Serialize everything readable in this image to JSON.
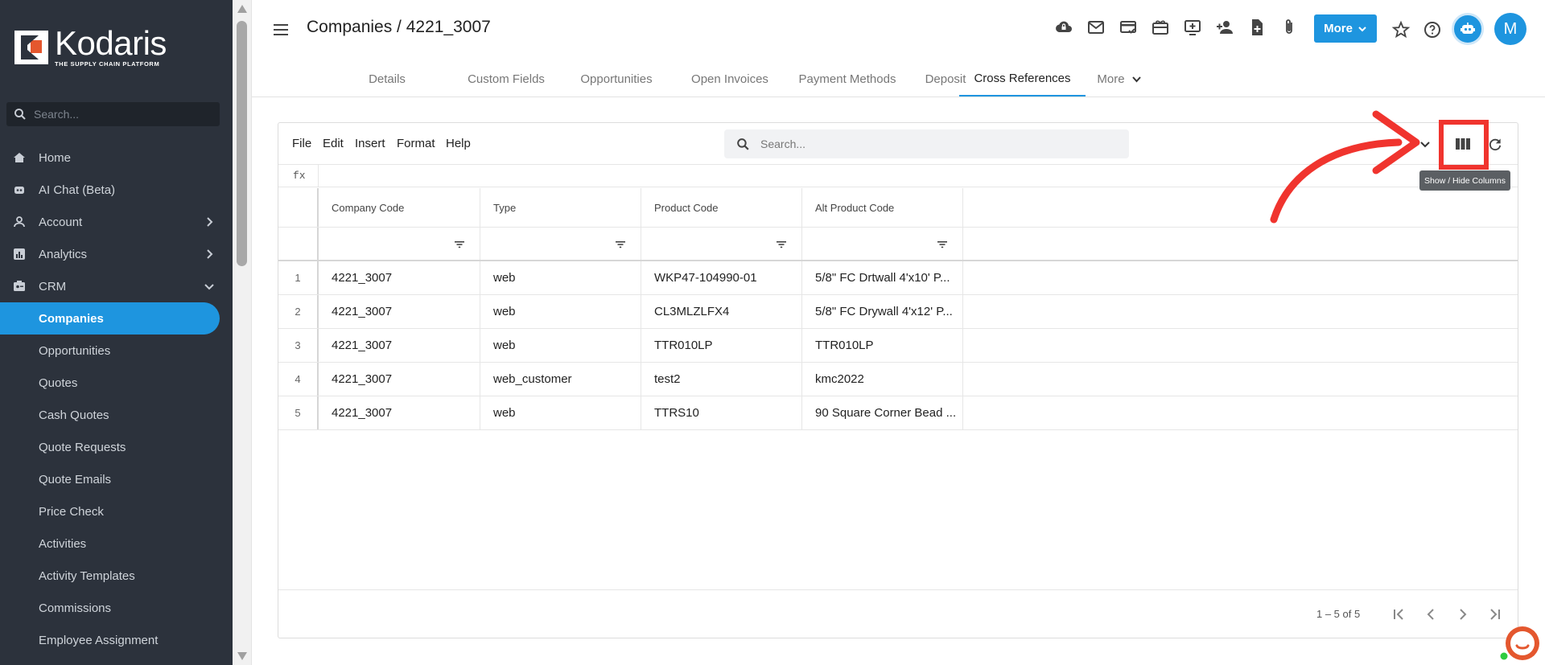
{
  "app": {
    "logo_name": "Kodaris",
    "logo_tagline": "THE SUPPLY CHAIN PLATFORM",
    "breadcrumb": "Companies / 4221_3007",
    "user_initial": "M",
    "accent_color": "#1e95df",
    "sidebar_color": "#2c323c",
    "annotation_color": "#f0342e"
  },
  "sidebar": {
    "search_placeholder": "Search...",
    "items": [
      {
        "label": "Home",
        "icon": "home-icon",
        "type": "top"
      },
      {
        "label": "AI Chat (Beta)",
        "icon": "robot-icon",
        "type": "top"
      },
      {
        "label": "Account",
        "icon": "person-icon",
        "type": "top",
        "expand": "chevron-right"
      },
      {
        "label": "Analytics",
        "icon": "analytics-icon",
        "type": "top",
        "expand": "chevron-right"
      },
      {
        "label": "CRM",
        "icon": "crm-icon",
        "type": "top",
        "expand": "chevron-down"
      },
      {
        "label": "Companies",
        "type": "sub",
        "active": true
      },
      {
        "label": "Opportunities",
        "type": "sub"
      },
      {
        "label": "Quotes",
        "type": "sub"
      },
      {
        "label": "Cash Quotes",
        "type": "sub"
      },
      {
        "label": "Quote Requests",
        "type": "sub"
      },
      {
        "label": "Quote Emails",
        "type": "sub"
      },
      {
        "label": "Price Check",
        "type": "sub"
      },
      {
        "label": "Activities",
        "type": "sub"
      },
      {
        "label": "Activity Templates",
        "type": "sub"
      },
      {
        "label": "Commissions",
        "type": "sub"
      },
      {
        "label": "Employee Assignment",
        "type": "sub"
      }
    ]
  },
  "header": {
    "icons": [
      "cloud-lock-icon",
      "mail-icon",
      "payment-check-icon",
      "gift-card-icon",
      "add-to-queue-icon",
      "person-add-icon",
      "note-add-icon",
      "paperclip-icon"
    ],
    "more_label": "More",
    "right_icons": [
      "star-icon",
      "help-icon",
      "robot-assistant-icon"
    ]
  },
  "tabs": [
    {
      "label": "Details"
    },
    {
      "label": "Custom Fields"
    },
    {
      "label": "Opportunities"
    },
    {
      "label": "Open Invoices"
    },
    {
      "label": "Payment Methods"
    },
    {
      "label": "Deposit"
    },
    {
      "label": "Cross References",
      "active": true
    },
    {
      "label": "More",
      "dropdown": true
    }
  ],
  "sheet": {
    "menus": [
      "File",
      "Edit",
      "Insert",
      "Format",
      "Help"
    ],
    "search_placeholder": "Search...",
    "toolbar_icons": [
      "chevron-down-icon",
      "columns-icon",
      "refresh-icon"
    ],
    "tooltip": "Show / Hide Columns",
    "formula_label": "fx",
    "columns": [
      "Company Code",
      "Type",
      "Product Code",
      "Alt Product Code"
    ],
    "rows": [
      {
        "num": "1",
        "cells": [
          "4221_3007",
          "web",
          "WKP47-104990-01",
          "5/8\" FC Drtwall 4'x10' P..."
        ]
      },
      {
        "num": "2",
        "cells": [
          "4221_3007",
          "web",
          "CL3MLZLFX4",
          "5/8\" FC Drywall 4'x12' P..."
        ]
      },
      {
        "num": "3",
        "cells": [
          "4221_3007",
          "web",
          "TTR010LP",
          "TTR010LP"
        ]
      },
      {
        "num": "4",
        "cells": [
          "4221_3007",
          "web_customer",
          "test2",
          "kmc2022"
        ]
      },
      {
        "num": "5",
        "cells": [
          "4221_3007",
          "web",
          "TTRS10",
          "90 Square Corner Bead ..."
        ]
      }
    ],
    "range_label": "1 – 5 of 5",
    "pager_icons": [
      "first-page-icon",
      "prev-page-icon",
      "next-page-icon",
      "last-page-icon"
    ]
  }
}
